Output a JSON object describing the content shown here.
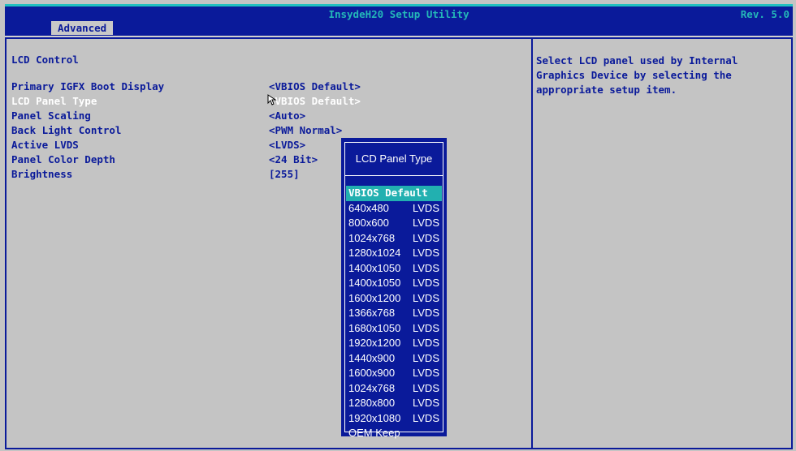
{
  "header": {
    "title": "InsydeH20 Setup Utility",
    "revision": "Rev. 5.0"
  },
  "tabs": [
    {
      "label": "Advanced",
      "active": true
    }
  ],
  "main": {
    "section_title": "LCD Control",
    "settings": [
      {
        "label": "Primary IGFX Boot Display",
        "value": "<VBIOS Default>"
      },
      {
        "label": "LCD Panel Type",
        "value": "<VBIOS Default>",
        "selected": true
      },
      {
        "label": "Panel Scaling",
        "value": "<Auto>"
      },
      {
        "label": "Back Light Control",
        "value": "<PWM Normal>"
      },
      {
        "label": "Active LVDS",
        "value": "<LVDS>"
      },
      {
        "label": "Panel Color Depth",
        "value": "<24 Bit>"
      },
      {
        "label": "Brightness",
        "value": "[255]"
      }
    ]
  },
  "help": {
    "text": "Select LCD panel used by Internal\nGraphics Device by selecting the\nappropriate setup item."
  },
  "popup": {
    "title": "LCD Panel Type",
    "options": [
      {
        "resolution": "VBIOS Default",
        "type": "",
        "selected": true
      },
      {
        "resolution": "640x480",
        "type": "LVDS"
      },
      {
        "resolution": "800x600",
        "type": "LVDS"
      },
      {
        "resolution": "1024x768",
        "type": "LVDS"
      },
      {
        "resolution": "1280x1024",
        "type": "LVDS"
      },
      {
        "resolution": "1400x1050",
        "type": "LVDS"
      },
      {
        "resolution": "1400x1050",
        "type": "LVDS"
      },
      {
        "resolution": "1600x1200",
        "type": "LVDS"
      },
      {
        "resolution": "1366x768",
        "type": "LVDS"
      },
      {
        "resolution": "1680x1050",
        "type": "LVDS"
      },
      {
        "resolution": "1920x1200",
        "type": "LVDS"
      },
      {
        "resolution": "1440x900",
        "type": "LVDS"
      },
      {
        "resolution": "1600x900",
        "type": "LVDS"
      },
      {
        "resolution": "1024x768",
        "type": "LVDS"
      },
      {
        "resolution": "1280x800",
        "type": "LVDS"
      },
      {
        "resolution": "1920x1080",
        "type": "LVDS"
      },
      {
        "resolution": "OEM Keep",
        "type": ""
      }
    ]
  },
  "colors": {
    "bios_blue": "#0a1a9a",
    "background_gray": "#c4c4c4",
    "highlight_cyan": "#22b0b0"
  },
  "icons": {
    "cursor": "mouse-pointer-icon"
  }
}
